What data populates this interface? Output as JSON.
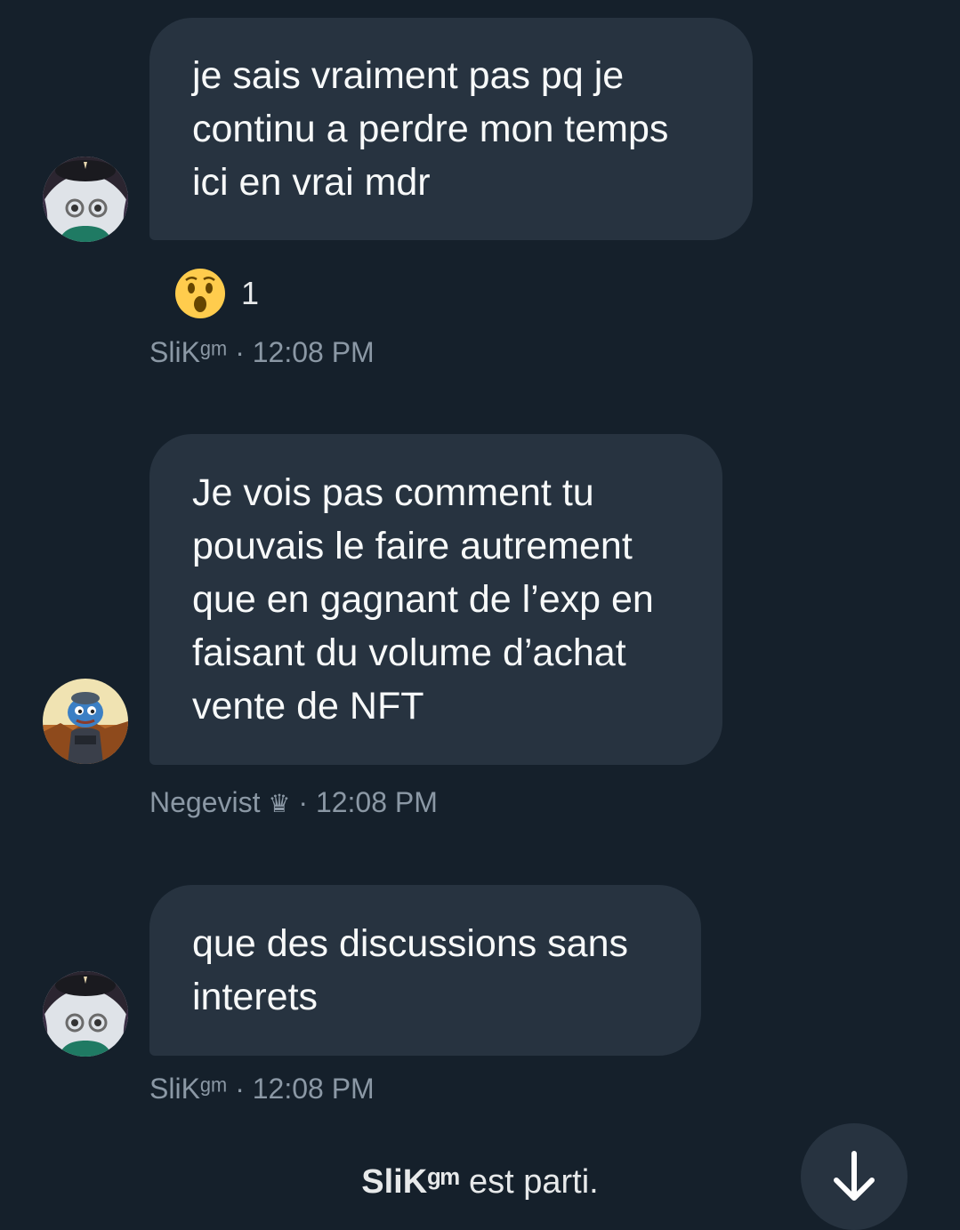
{
  "messages": [
    {
      "text": "je sais vraiment pas pq je\ncontinu a perdre mon temps\nici en vrai mdr",
      "author": "SliKᵍᵐ",
      "time": "· 12:08 PM",
      "avatar": "anime-avatar",
      "reaction": {
        "emoji": "😲",
        "emoji_name": "astonished-face-icon",
        "count": "1"
      }
    },
    {
      "text": "Je vois pas comment tu\npouvais le faire autrement\nque en gagnant de l’exp en\nfaisant du volume d’achat\nvente de NFT",
      "author": "Negevist",
      "author_badge": "♛",
      "time": "· 12:08 PM",
      "avatar": "pepe-avatar"
    },
    {
      "text": "que des discussions sans\ninterets",
      "author": "SliKᵍᵐ",
      "time": "· 12:08 PM",
      "avatar": "anime-avatar"
    }
  ],
  "status": {
    "name": "SliKᵍᵐ",
    "text": " est parti."
  },
  "scroll_button": {
    "icon": "arrow-down-icon"
  },
  "colors": {
    "background": "#15202b",
    "bubble": "#273340",
    "meta_text": "#8b98a5",
    "text": "#f7f9f9"
  }
}
